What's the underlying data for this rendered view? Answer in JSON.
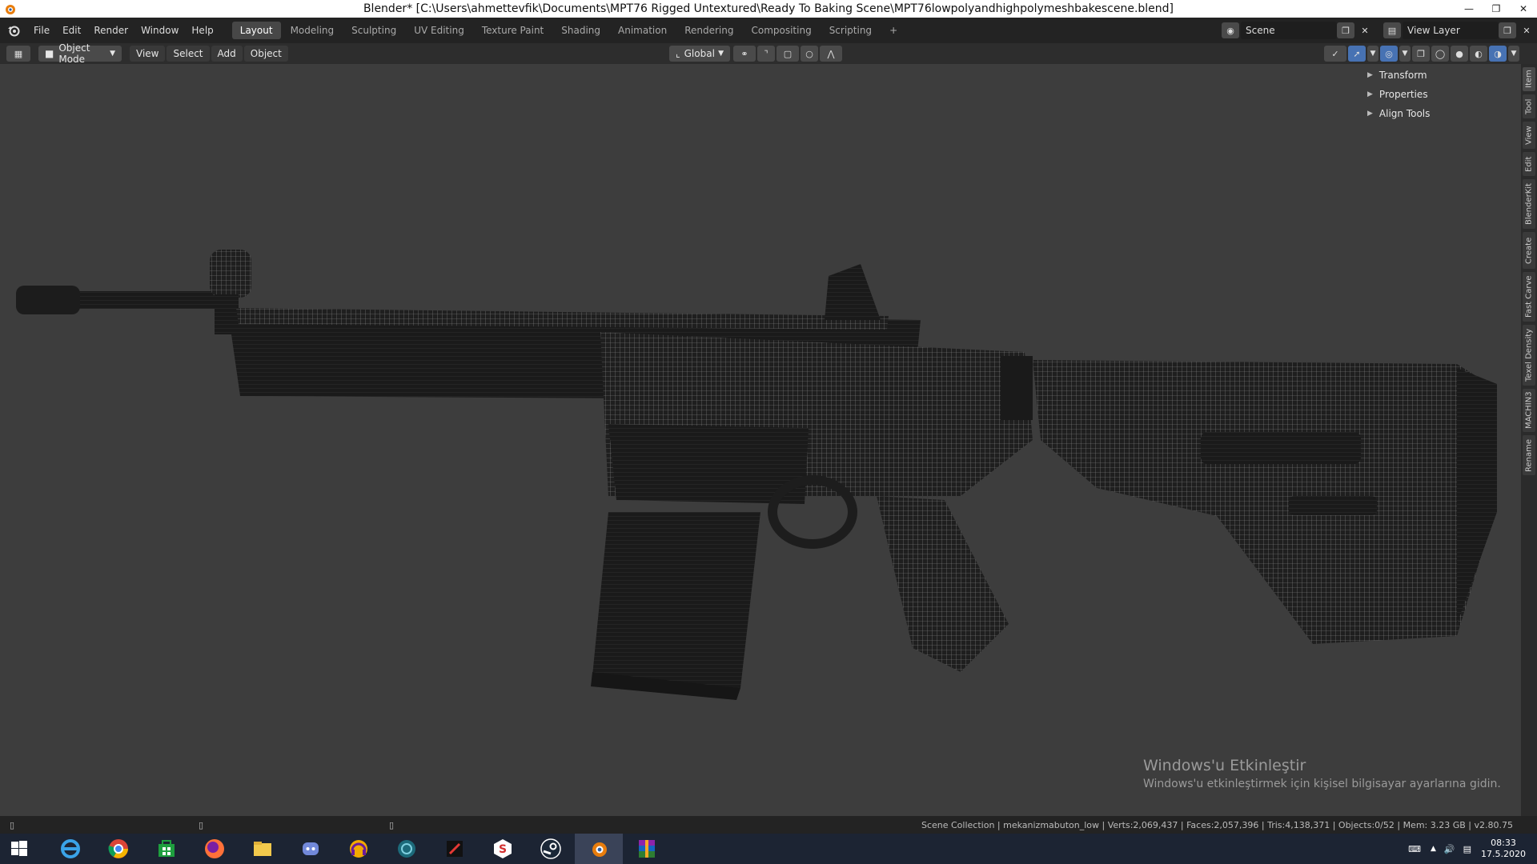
{
  "window": {
    "title": "Blender* [C:\\Users\\ahmettevfik\\Documents\\MPT76 Rigged Untextured\\Ready To Baking Scene\\MPT76lowpolyandhighpolymeshbakescene.blend]"
  },
  "menu": [
    "File",
    "Edit",
    "Render",
    "Window",
    "Help"
  ],
  "workspaces": [
    "Layout",
    "Modeling",
    "Sculpting",
    "UV Editing",
    "Texture Paint",
    "Shading",
    "Animation",
    "Rendering",
    "Compositing",
    "Scripting"
  ],
  "active_workspace": "Layout",
  "scene": {
    "label": "Scene"
  },
  "view_layer": {
    "label": "View Layer"
  },
  "header": {
    "mode": "Object Mode",
    "menus": [
      "View",
      "Select",
      "Add",
      "Object"
    ],
    "orientation": "Global"
  },
  "npanel": {
    "items": [
      "Transform",
      "Properties",
      "Align Tools"
    ]
  },
  "side_tabs": [
    "Item",
    "Tool",
    "View",
    "Edit",
    "BlenderKit",
    "Create",
    "Fast Carve",
    "Texel Density",
    "MACHIN3",
    "Rename"
  ],
  "watermark": {
    "title": "Windows'u Etkinleştir",
    "subtitle": "Windows'u etkinleştirmek için kişisel bilgisayar ayarlarına gidin."
  },
  "status": {
    "stats": "Scene Collection | mekanizmabuton_low | Verts:2,069,437 | Faces:2,057,396 | Tris:4,138,371 | Objects:0/52 | Mem: 3.23 GB | v2.80.75"
  },
  "taskbar": {
    "apps": [
      "internet-explorer",
      "chrome",
      "store",
      "firefox",
      "file-explorer",
      "discord",
      "audio-app",
      "globe-app",
      "editor-app",
      "substance",
      "steam",
      "blender",
      "winrar"
    ],
    "time": "08:33",
    "date": "17.5.2020"
  },
  "colors": {
    "accent": "#4772b3",
    "viewport_bg": "#3d3d3d",
    "taskbar_bg": "#1c2433"
  }
}
